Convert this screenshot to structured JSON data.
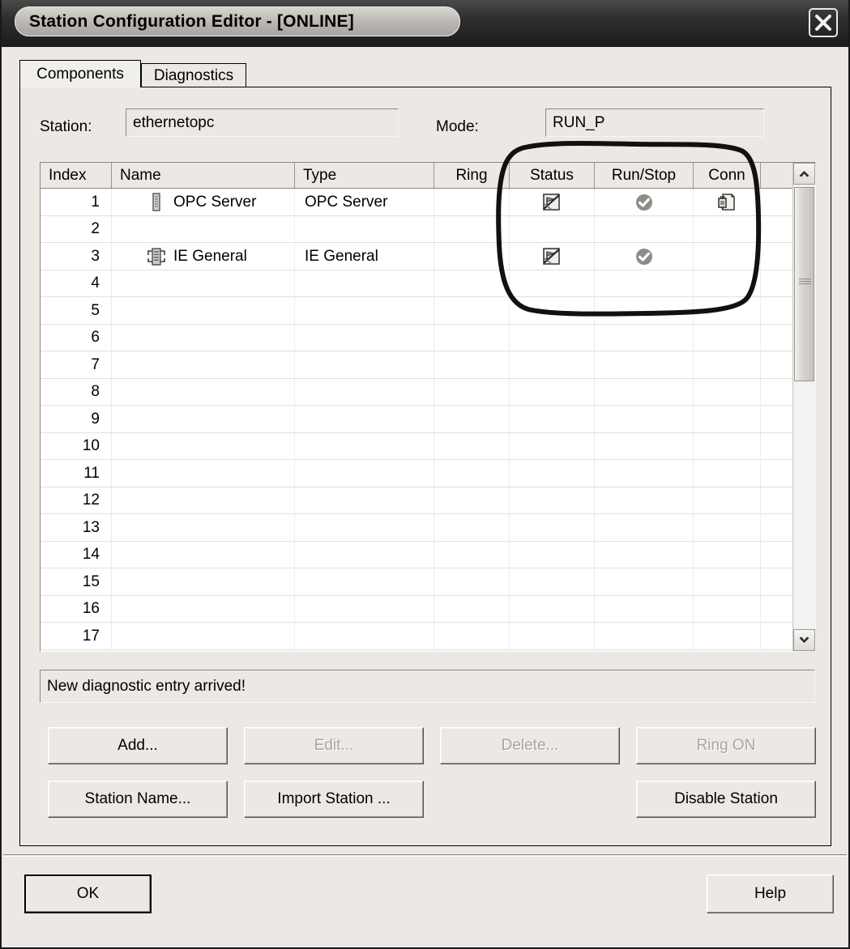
{
  "window": {
    "title": "Station Configuration Editor  - [ONLINE]",
    "close_icon": "close-icon"
  },
  "tabs": [
    {
      "label": "Components",
      "active": true
    },
    {
      "label": "Diagnostics",
      "active": false
    }
  ],
  "fields": {
    "station_label": "Station:",
    "station_value": "ethernetopc",
    "mode_label": "Mode:",
    "mode_value": "RUN_P"
  },
  "table": {
    "columns": [
      "Index",
      "Name",
      "Type",
      "Ring",
      "Status",
      "Run/Stop",
      "Conn"
    ],
    "rows": [
      {
        "index": "1",
        "icon": "module-icon",
        "name": "OPC Server",
        "type": "OPC Server",
        "ring": "",
        "status": "flag-disabled-icon",
        "runstop": "check-circle-icon",
        "conn": "connection-document-icon"
      },
      {
        "index": "2",
        "icon": "",
        "name": "",
        "type": "",
        "ring": "",
        "status": "",
        "runstop": "",
        "conn": ""
      },
      {
        "index": "3",
        "icon": "network-module-icon",
        "name": "IE General",
        "type": "IE General",
        "ring": "",
        "status": "flag-disabled-icon",
        "runstop": "check-circle-icon",
        "conn": ""
      },
      {
        "index": "4",
        "icon": "",
        "name": "",
        "type": "",
        "ring": "",
        "status": "",
        "runstop": "",
        "conn": ""
      },
      {
        "index": "5",
        "icon": "",
        "name": "",
        "type": "",
        "ring": "",
        "status": "",
        "runstop": "",
        "conn": ""
      },
      {
        "index": "6",
        "icon": "",
        "name": "",
        "type": "",
        "ring": "",
        "status": "",
        "runstop": "",
        "conn": ""
      },
      {
        "index": "7",
        "icon": "",
        "name": "",
        "type": "",
        "ring": "",
        "status": "",
        "runstop": "",
        "conn": ""
      },
      {
        "index": "8",
        "icon": "",
        "name": "",
        "type": "",
        "ring": "",
        "status": "",
        "runstop": "",
        "conn": ""
      },
      {
        "index": "9",
        "icon": "",
        "name": "",
        "type": "",
        "ring": "",
        "status": "",
        "runstop": "",
        "conn": ""
      },
      {
        "index": "10",
        "icon": "",
        "name": "",
        "type": "",
        "ring": "",
        "status": "",
        "runstop": "",
        "conn": ""
      },
      {
        "index": "11",
        "icon": "",
        "name": "",
        "type": "",
        "ring": "",
        "status": "",
        "runstop": "",
        "conn": ""
      },
      {
        "index": "12",
        "icon": "",
        "name": "",
        "type": "",
        "ring": "",
        "status": "",
        "runstop": "",
        "conn": ""
      },
      {
        "index": "13",
        "icon": "",
        "name": "",
        "type": "",
        "ring": "",
        "status": "",
        "runstop": "",
        "conn": ""
      },
      {
        "index": "14",
        "icon": "",
        "name": "",
        "type": "",
        "ring": "",
        "status": "",
        "runstop": "",
        "conn": ""
      },
      {
        "index": "15",
        "icon": "",
        "name": "",
        "type": "",
        "ring": "",
        "status": "",
        "runstop": "",
        "conn": ""
      },
      {
        "index": "16",
        "icon": "",
        "name": "",
        "type": "",
        "ring": "",
        "status": "",
        "runstop": "",
        "conn": ""
      },
      {
        "index": "17",
        "icon": "",
        "name": "",
        "type": "",
        "ring": "",
        "status": "",
        "runstop": "",
        "conn": ""
      }
    ],
    "scrollbar": {
      "up_icon": "chevron-up-icon",
      "down_icon": "chevron-down-icon"
    }
  },
  "status_message": "New diagnostic entry arrived!",
  "buttons": {
    "add": "Add...",
    "edit": "Edit...",
    "delete": "Delete...",
    "ring_on": "Ring ON",
    "station_name": "Station Name...",
    "import_station": "Import Station ...",
    "disable_station": "Disable Station",
    "ok": "OK",
    "help": "Help"
  },
  "annotation": {
    "shape": "hand-drawn-rounded-rectangle",
    "color": "#111111",
    "target": "Status / Run-Stop / Conn columns"
  },
  "colors": {
    "dialog_face": "#ece9e4",
    "titlebar": "#1c1c1c",
    "field_bg": "#ece9e4",
    "table_bg": "#ffffff",
    "disabled_text": "#a8a5a0",
    "icon_gray": "#808080"
  }
}
